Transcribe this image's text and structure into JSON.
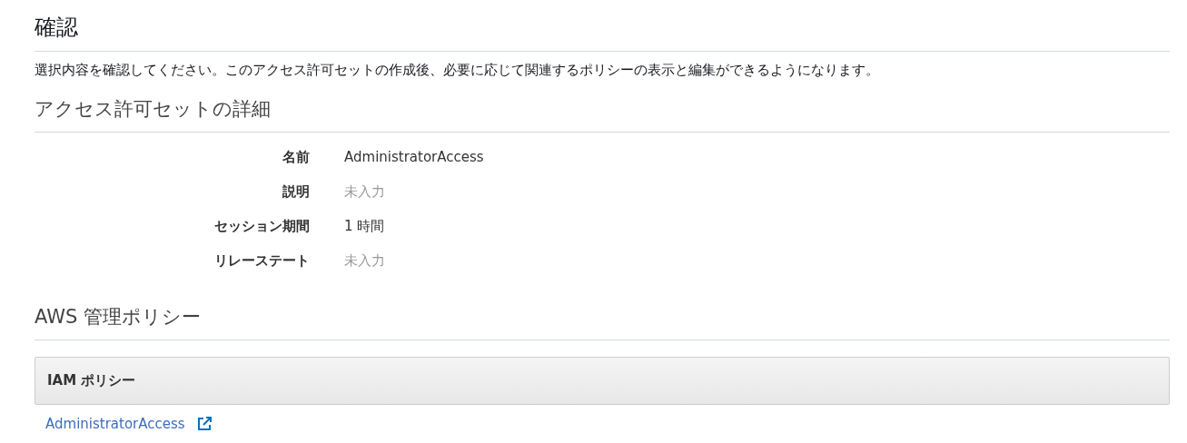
{
  "page": {
    "title": "確認",
    "description": "選択内容を確認してください。このアクセス許可セットの作成後、必要に応じて関連するポリシーの表示と編集ができるようになります。"
  },
  "details": {
    "heading": "アクセス許可セットの詳細",
    "fields": [
      {
        "label": "名前",
        "value": "AdministratorAccess",
        "empty": false
      },
      {
        "label": "説明",
        "value": "未入力",
        "empty": true
      },
      {
        "label": "セッション期間",
        "value": "1 時間",
        "empty": false
      },
      {
        "label": "リレーステート",
        "value": "未入力",
        "empty": true
      }
    ]
  },
  "managed_policies": {
    "heading": "AWS 管理ポリシー",
    "table": {
      "columns": [
        "IAM ポリシー"
      ],
      "rows": [
        {
          "policy": "AdministratorAccess",
          "external_link": true
        }
      ]
    }
  }
}
